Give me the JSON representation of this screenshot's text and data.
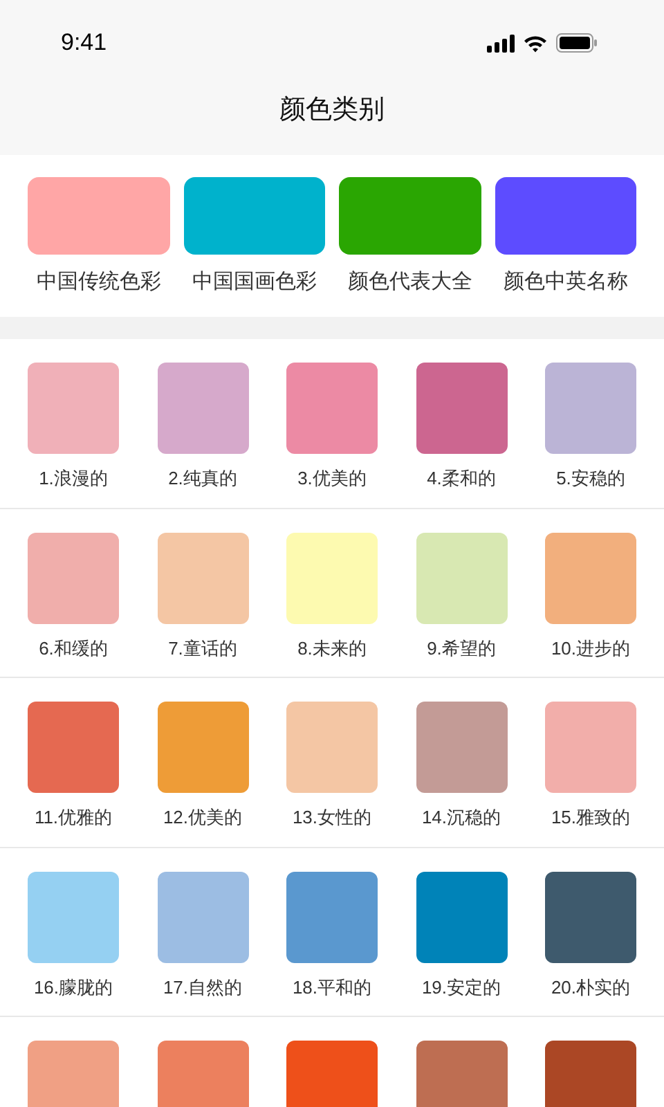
{
  "status_bar": {
    "time": "9:41"
  },
  "header": {
    "title": "颜色类别"
  },
  "categories": [
    {
      "label": "中国传统色彩",
      "color": "#ffa6a6"
    },
    {
      "label": "中国国画色彩",
      "color": "#00b2cc"
    },
    {
      "label": "颜色代表大全",
      "color": "#2aa602"
    },
    {
      "label": "颜色中英名称",
      "color": "#5d4cff"
    }
  ],
  "swatches": [
    {
      "label": "1.浪漫的",
      "color": "#f0b0b8"
    },
    {
      "label": "2.纯真的",
      "color": "#d6a9cb"
    },
    {
      "label": "3.优美的",
      "color": "#ec8aa4"
    },
    {
      "label": "4.柔和的",
      "color": "#cc6690"
    },
    {
      "label": "5.安稳的",
      "color": "#bbb4d6"
    },
    {
      "label": "6.和缓的",
      "color": "#f0aeab"
    },
    {
      "label": "7.童话的",
      "color": "#f4c6a4"
    },
    {
      "label": "8.未来的",
      "color": "#fdfab0"
    },
    {
      "label": "9.希望的",
      "color": "#d8e8b2"
    },
    {
      "label": "10.进步的",
      "color": "#f2af7d"
    },
    {
      "label": "11.优雅的",
      "color": "#e56951"
    },
    {
      "label": "12.优美的",
      "color": "#ee9c37"
    },
    {
      "label": "13.女性的",
      "color": "#f4c6a4"
    },
    {
      "label": "14.沉稳的",
      "color": "#c39b96"
    },
    {
      "label": "15.雅致的",
      "color": "#f2aeaa"
    },
    {
      "label": "16.朦胧的",
      "color": "#95d0f2"
    },
    {
      "label": "17.自然的",
      "color": "#9cbde3"
    },
    {
      "label": "18.平和的",
      "color": "#5a98cf"
    },
    {
      "label": "19.安定的",
      "color": "#0083b8"
    },
    {
      "label": "20.朴实的",
      "color": "#3e5a6d"
    },
    {
      "color": "#f0a084"
    },
    {
      "color": "#ec805e"
    },
    {
      "color": "#ee501a"
    },
    {
      "color": "#be6e52"
    },
    {
      "color": "#ab4725"
    }
  ]
}
